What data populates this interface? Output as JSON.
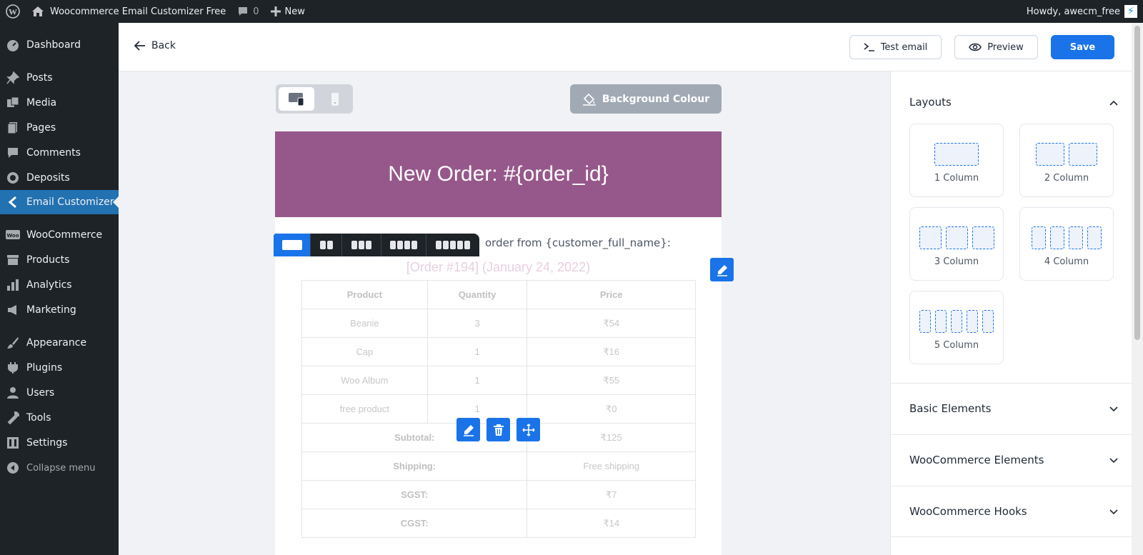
{
  "admin_bar": {
    "site_name": "Woocommerce Email Customizer Free",
    "comments_count": "0",
    "new_label": "New",
    "greeting": "Howdy, awecm_free"
  },
  "sidebar": {
    "items": [
      {
        "label": "Dashboard",
        "icon": "dashboard-icon"
      },
      {
        "label": "Posts",
        "icon": "pin-icon"
      },
      {
        "label": "Media",
        "icon": "media-icon"
      },
      {
        "label": "Pages",
        "icon": "pages-icon"
      },
      {
        "label": "Comments",
        "icon": "comment-icon"
      },
      {
        "label": "Deposits",
        "icon": "deposits-icon"
      },
      {
        "label": "Email Customizer",
        "icon": "chevron-left-icon",
        "active": true
      },
      {
        "label": "WooCommerce",
        "icon": "woo-icon"
      },
      {
        "label": "Products",
        "icon": "archive-icon"
      },
      {
        "label": "Analytics",
        "icon": "bar-chart-icon"
      },
      {
        "label": "Marketing",
        "icon": "megaphone-icon"
      },
      {
        "label": "Appearance",
        "icon": "brush-icon"
      },
      {
        "label": "Plugins",
        "icon": "plugin-icon"
      },
      {
        "label": "Users",
        "icon": "user-icon"
      },
      {
        "label": "Tools",
        "icon": "wrench-icon"
      },
      {
        "label": "Settings",
        "icon": "settings-icon"
      },
      {
        "label": "Collapse menu",
        "icon": "collapse-icon"
      }
    ]
  },
  "toolbar": {
    "back_label": "Back",
    "test_email_label": "Test email",
    "preview_label": "Preview",
    "save_label": "Save"
  },
  "canvas": {
    "background_colour_label": "Background Colour"
  },
  "email": {
    "header_title": "New Order: #{order_id}",
    "intro_text": "order from {customer_full_name}:",
    "order_heading": "[Order #194] (January 24, 2022)",
    "table": {
      "headers": [
        "Product",
        "Quantity",
        "Price"
      ],
      "items": [
        {
          "product": "Beanie",
          "quantity": "3",
          "price": "₹54"
        },
        {
          "product": "Cap",
          "quantity": "1",
          "price": "₹16"
        },
        {
          "product": "Woo Album",
          "quantity": "1",
          "price": "₹55"
        },
        {
          "product": "free product",
          "quantity": "1",
          "price": "₹0"
        }
      ],
      "totals": [
        {
          "label": "Subtotal:",
          "value": "₹125"
        },
        {
          "label": "Shipping:",
          "value": "Free shipping"
        },
        {
          "label": "SGST:",
          "value": "₹7"
        },
        {
          "label": "CGST:",
          "value": "₹14"
        }
      ]
    }
  },
  "panel": {
    "layouts_title": "Layouts",
    "layouts": [
      {
        "label": "1 Column",
        "cols": 1
      },
      {
        "label": "2 Column",
        "cols": 2
      },
      {
        "label": "3 Column",
        "cols": 3
      },
      {
        "label": "4 Column",
        "cols": 4
      },
      {
        "label": "5 Column",
        "cols": 5
      }
    ],
    "sections": [
      {
        "label": "Basic Elements"
      },
      {
        "label": "WooCommerce Elements"
      },
      {
        "label": "WooCommerce Hooks"
      }
    ]
  },
  "colors": {
    "primary": "#1a73e8",
    "email_header": "#96588a",
    "admin_dark": "#1d2327",
    "active_menu": "#2271b1"
  }
}
